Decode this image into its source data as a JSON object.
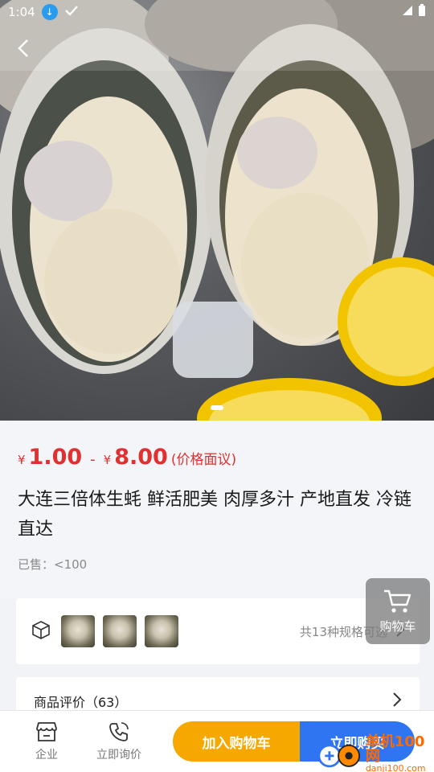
{
  "status_bar": {
    "time": "1:04"
  },
  "product": {
    "price_currency": "¥",
    "price_low": "1.00",
    "price_separator": "-",
    "price_high": "8.00",
    "price_note": "(价格面议)",
    "title": "大连三倍体生蚝 鲜活肥美 肉厚多汁 产地直发 冷链直达",
    "sold": "已售：<100"
  },
  "spec": {
    "summary": "共13种规格可选"
  },
  "reviews": {
    "label": "商品评价（63）"
  },
  "floating_cart": {
    "label": "购物车"
  },
  "bottom_bar": {
    "shop_label": "企业",
    "inquiry_label": "立即询价",
    "add_to_cart": "加入购物车",
    "buy_now": "立即购买"
  },
  "watermark": {
    "name": "单机100网",
    "url": "danji100.com"
  },
  "colors": {
    "price_red": "#e03030",
    "add_orange": "#f7a800",
    "buy_blue": "#2f74f0"
  }
}
